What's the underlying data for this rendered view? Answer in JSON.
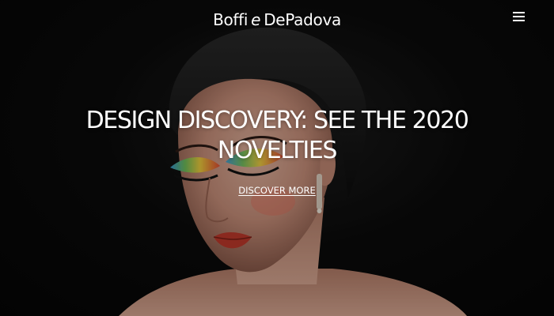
{
  "header": {
    "logo_part1": "Boffi",
    "logo_part2": "e",
    "logo_part3": "DePadova"
  },
  "icons": {
    "menu": "hamburger-menu-icon"
  },
  "hero": {
    "headline_line1": "DESIGN DISCOVERY: SEE THE 2020",
    "headline_line2": "NOVELTIES",
    "cta_label": "DISCOVER MORE"
  },
  "colors": {
    "background": "#000000",
    "text": "#ffffff"
  }
}
